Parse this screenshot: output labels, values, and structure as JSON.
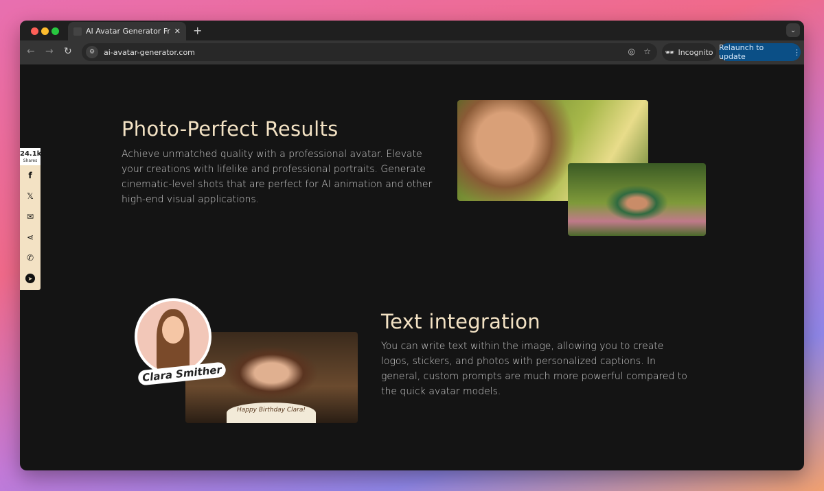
{
  "browser": {
    "tab_title": "AI Avatar Generator Free: Cre",
    "url": "ai-avatar-generator.com",
    "incognito_label": "Incognito",
    "relaunch_label": "Relaunch to update"
  },
  "share": {
    "count": "24.1k",
    "label": "Shares",
    "icons": [
      "facebook-icon",
      "x-icon",
      "email-icon",
      "share-icon",
      "whatsapp-icon",
      "telegram-icon"
    ]
  },
  "section1": {
    "title": "Photo-Perfect Results",
    "body": "Achieve unmatched quality with a professional avatar. Elevate your creations with lifelike and professional portraits. Generate cinematic-level shots that are perfect for AI animation and other high-end visual applications."
  },
  "section2": {
    "title": "Text integration",
    "body": "You can write text within the image, allowing you to create logos, stickers, and photos with personalized captions. In general, custom prompts are much more powerful compared to the quick avatar models.",
    "sticker_text": "Clara Smither",
    "cake_text": "Happy Birthday Clara!"
  },
  "colors": {
    "heading": "#f3e2c4",
    "background": "#141414",
    "relaunch": "#0b4f86"
  }
}
